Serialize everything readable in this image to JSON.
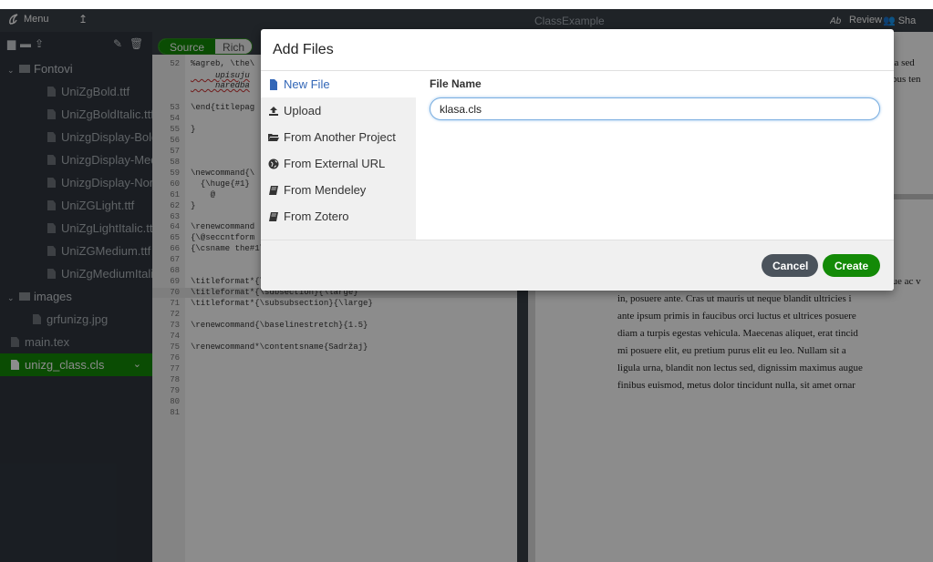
{
  "topbar": {
    "menu_label": "Menu",
    "title": "ClassExample",
    "review_label": "Review",
    "share_label": "Sha"
  },
  "filetree": {
    "items": [
      {
        "type": "folder",
        "label": "Fontovi"
      },
      {
        "type": "file",
        "label": "UniZgBold.ttf"
      },
      {
        "type": "file",
        "label": "UniZgBoldItalic.ttf"
      },
      {
        "type": "file",
        "label": "UnizgDisplay-Bold..."
      },
      {
        "type": "file",
        "label": "UnizgDisplay-Med..."
      },
      {
        "type": "file",
        "label": "UnizgDisplay-Nor..."
      },
      {
        "type": "file",
        "label": "UniZGLight.ttf"
      },
      {
        "type": "file",
        "label": "UniZgLightItalic.ttf"
      },
      {
        "type": "file",
        "label": "UniZGMedium.ttf"
      },
      {
        "type": "file",
        "label": "UniZgMediumItali..."
      },
      {
        "type": "folder",
        "label": "images"
      },
      {
        "type": "file",
        "label": "grfunizg.jpg"
      },
      {
        "type": "file",
        "label": "main.tex"
      },
      {
        "type": "file",
        "label": "unizg_class.cls"
      }
    ]
  },
  "editor": {
    "tab_source": "Source",
    "tab_rich": "Rich",
    "lines": [
      {
        "n": "52",
        "code": "%agreb, \\the\\"
      },
      {
        "n": "",
        "code": "     upisuju"
      },
      {
        "n": "",
        "code": "     naredba"
      },
      {
        "n": "53",
        "code": "\\end{titlepag"
      },
      {
        "n": "54",
        "code": ""
      },
      {
        "n": "55",
        "code": "}"
      },
      {
        "n": "56",
        "code": ""
      },
      {
        "n": "57",
        "code": ""
      },
      {
        "n": "58",
        "code": ""
      },
      {
        "n": "59",
        "code": "\\newcommand{\\"
      },
      {
        "n": "60",
        "code": "  {\\huge{#1}"
      },
      {
        "n": "61",
        "code": "    @"
      },
      {
        "n": "62",
        "code": "}"
      },
      {
        "n": "63",
        "code": ""
      },
      {
        "n": "64",
        "code": "\\renewcommand"
      },
      {
        "n": "65",
        "code": "{\\@seccntform"
      },
      {
        "n": "66",
        "code": "{\\csname the#1\\endcsname.\\quad}"
      },
      {
        "n": "67",
        "code": ""
      },
      {
        "n": "68",
        "code": ""
      },
      {
        "n": "69",
        "code": "\\titleformat*{\\section}{\\Large\\bfseries\\MakeUppercase}"
      },
      {
        "n": "70",
        "code": "\\titleformat*{\\subsection}{\\large}"
      },
      {
        "n": "71",
        "code": "\\titleformat*{\\subsubsection}{\\large}"
      },
      {
        "n": "72",
        "code": ""
      },
      {
        "n": "73",
        "code": "\\renewcommand{\\baselinestretch}{1.5}"
      },
      {
        "n": "74",
        "code": ""
      },
      {
        "n": "75",
        "code": "\\renewcommand*\\contentsname{Sadržaj}"
      },
      {
        "n": "76",
        "code": ""
      },
      {
        "n": "77",
        "code": ""
      },
      {
        "n": "78",
        "code": ""
      },
      {
        "n": "79",
        "code": ""
      },
      {
        "n": "80",
        "code": ""
      },
      {
        "n": "81",
        "code": ""
      }
    ]
  },
  "preview": {
    "top_lines": [
      "na sed",
      "ibus ten"
    ],
    "lines": [
      "que ac v",
      "in, posuere ante. Cras ut mauris ut neque blandit ultricies i",
      "ante ipsum primis in faucibus orci luctus et ultrices posuere",
      "diam a turpis egestas vehicula. Maecenas aliquet, erat tincid",
      "mi posuere elit, eu pretium purus elit eu leo. Nullam sit a",
      "ligula urna, blandit non lectus sed, dignissim maximus augue",
      "finibus euismod, metus dolor tincidunt nulla, sit amet ornar"
    ]
  },
  "modal": {
    "title": "Add Files",
    "options": [
      {
        "label": "New File",
        "icon": "file-icon"
      },
      {
        "label": "Upload",
        "icon": "upload-icon"
      },
      {
        "label": "From Another Project",
        "icon": "folder-open-icon"
      },
      {
        "label": "From External URL",
        "icon": "globe-icon"
      },
      {
        "label": "From Mendeley",
        "icon": "book-icon"
      },
      {
        "label": "From Zotero",
        "icon": "book-icon"
      }
    ],
    "file_name_label": "File Name",
    "file_name_value": "klasa.cls",
    "cancel_label": "Cancel",
    "create_label": "Create"
  },
  "colors": {
    "accent_green": "#138a07",
    "link_blue": "#3367b7",
    "dark_chrome": "#3a4048"
  }
}
